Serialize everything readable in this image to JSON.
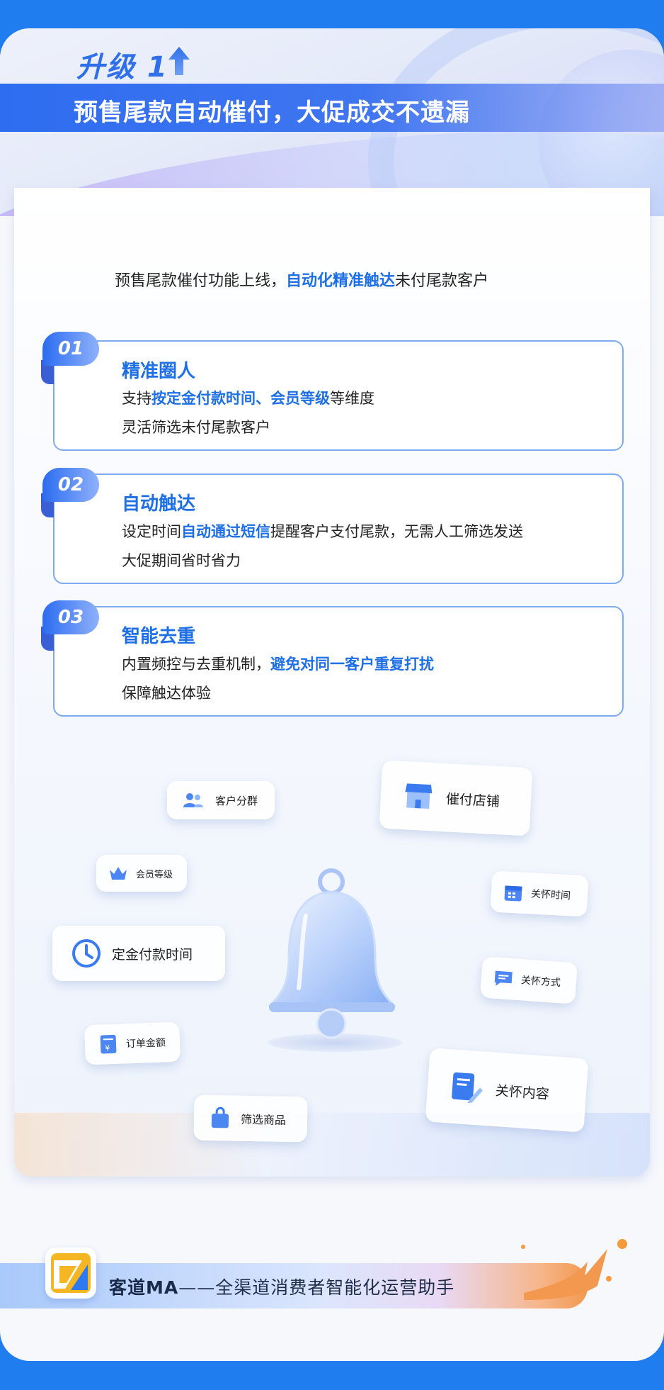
{
  "header": {
    "upgrade_label": "升级 1",
    "headline": "预售尾款自动催付，大促成交不遗漏"
  },
  "intro": {
    "prefix": "预售尾款催付功能上线，",
    "highlight": "自动化精准触达",
    "suffix": "未付尾款客户"
  },
  "features": [
    {
      "number": "01",
      "title": "精准圈人",
      "line1_prefix": "支持",
      "line1_highlight": "按定金付款时间、会员等级",
      "line1_suffix": "等维度",
      "line2": "灵活筛选未付尾款客户"
    },
    {
      "number": "02",
      "title": "自动触达",
      "line1_prefix": "设定时间",
      "line1_highlight": "自动通过短信",
      "line1_suffix": "提醒客户支付尾款，无需人工筛选发送",
      "line2": "大促期间省时省力"
    },
    {
      "number": "03",
      "title": "智能去重",
      "line1_prefix": "内置频控与去重机制，",
      "line1_highlight": "避免对同一客户重复打扰",
      "line1_suffix": "",
      "line2": "保障触达体验"
    }
  ],
  "chips": {
    "customer_group": "客户分群",
    "pay_store": "催付店铺",
    "member_level": "会员等级",
    "care_time": "关怀时间",
    "deposit_time": "定金付款时间",
    "care_method": "关怀方式",
    "order_amount": "订单金额",
    "care_content": "关怀内容",
    "filter_goods": "筛选商品"
  },
  "footer": {
    "brand": "客道MA",
    "tagline": "——全渠道消费者智能化运营助手"
  },
  "colors": {
    "primary": "#1f6fe5",
    "background": "#1f7df0",
    "accent_orange": "#f2994f"
  }
}
